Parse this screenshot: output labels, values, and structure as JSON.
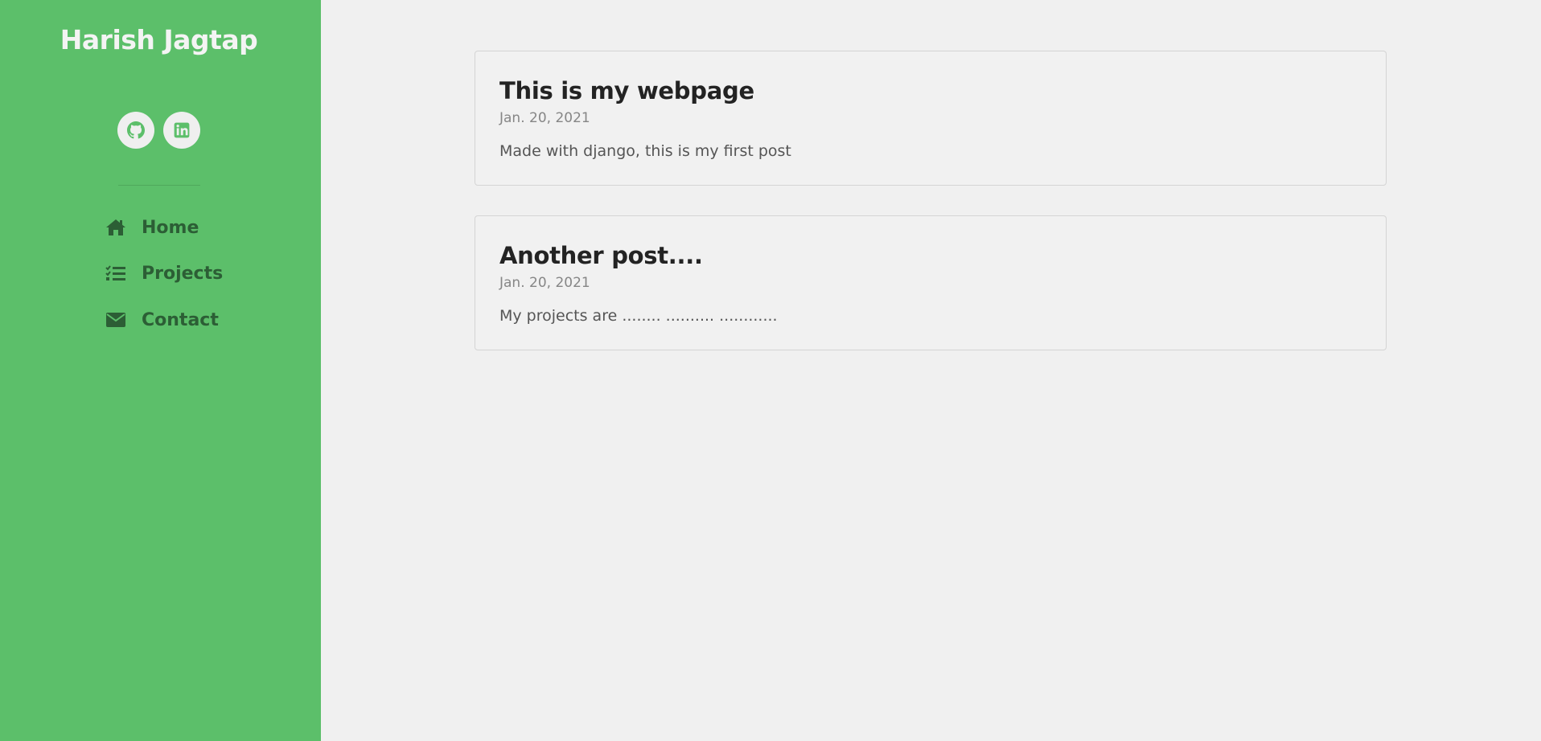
{
  "sidebar": {
    "brand": "Harish Jagtap",
    "social": [
      {
        "name": "github-icon"
      },
      {
        "name": "linkedin-icon"
      }
    ],
    "nav": [
      {
        "label": "Home",
        "icon": "home-icon"
      },
      {
        "label": "Projects",
        "icon": "tasks-icon"
      },
      {
        "label": "Contact",
        "icon": "envelope-icon"
      }
    ]
  },
  "posts": [
    {
      "title": "This is my webpage",
      "date": "Jan. 20, 2021",
      "body": "Made with django, this is my first post"
    },
    {
      "title": "Another post....",
      "date": "Jan. 20, 2021",
      "body": "My projects are ........ .......... ............"
    }
  ],
  "colors": {
    "sidebar_bg": "#5cbf6a",
    "brand_text": "#f4f4f4",
    "nav_text": "#2c5e35",
    "page_bg": "#f0f0f0"
  }
}
